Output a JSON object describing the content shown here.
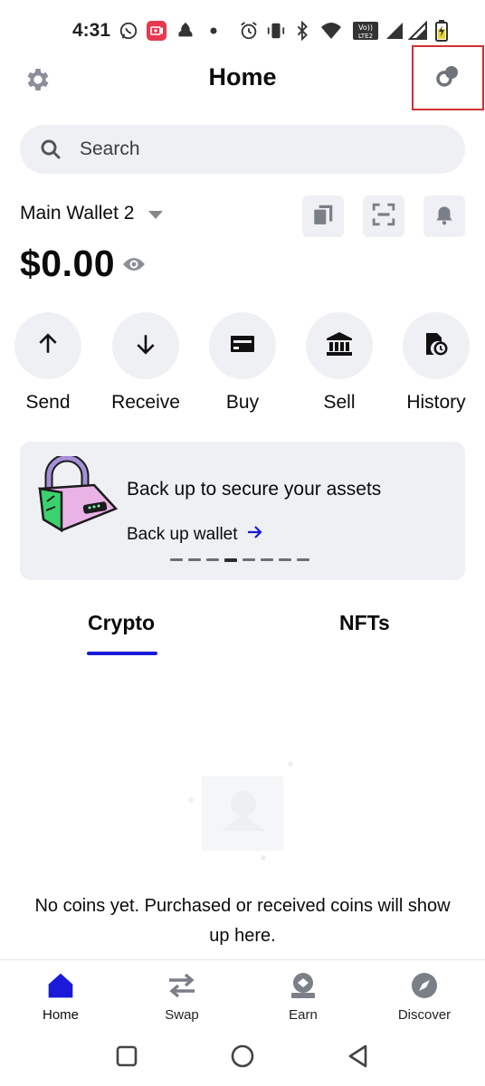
{
  "status_bar": {
    "time": "4:31",
    "icons": [
      "whatsapp-icon",
      "screen-record-icon",
      "lion-app-icon",
      "dot-icon",
      "alarm-icon",
      "vibrate-icon",
      "bluetooth-icon",
      "wifi-icon",
      "volte-icon",
      "signal-icon",
      "signal-icon",
      "battery-icon"
    ],
    "volte_text": "Vo)) LTE2"
  },
  "header": {
    "title": "Home",
    "left_icon": "gear-icon",
    "right_icon": "connected-dapps-icon"
  },
  "search": {
    "placeholder": "Search"
  },
  "wallet": {
    "name": "Main Wallet 2",
    "balance": "$0.00",
    "buttons": [
      "copy-icon",
      "scan-icon",
      "bell-icon"
    ]
  },
  "actions": [
    {
      "label": "Send",
      "icon": "arrow-up-icon"
    },
    {
      "label": "Receive",
      "icon": "arrow-down-icon"
    },
    {
      "label": "Buy",
      "icon": "card-icon"
    },
    {
      "label": "Sell",
      "icon": "bank-icon"
    },
    {
      "label": "History",
      "icon": "history-icon"
    }
  ],
  "backup": {
    "title": "Back up to secure your assets",
    "link": "Back up wallet",
    "page_count": 8,
    "active_page": 4
  },
  "tabs": [
    {
      "label": "Crypto",
      "active": true
    },
    {
      "label": "NFTs",
      "active": false
    }
  ],
  "empty_state": {
    "line1": "No coins yet. Purchased or received coins will show",
    "line2": "up here."
  },
  "bottom_nav": [
    {
      "label": "Home",
      "icon": "home-icon",
      "active": true
    },
    {
      "label": "Swap",
      "icon": "swap-icon",
      "active": false
    },
    {
      "label": "Earn",
      "icon": "earn-icon",
      "active": false
    },
    {
      "label": "Discover",
      "icon": "compass-icon",
      "active": false
    }
  ],
  "colors": {
    "accent": "#1a1ad8",
    "surface": "#eef0f3",
    "text": "#0a0b0d",
    "highlight_box": "#d32f2f"
  }
}
